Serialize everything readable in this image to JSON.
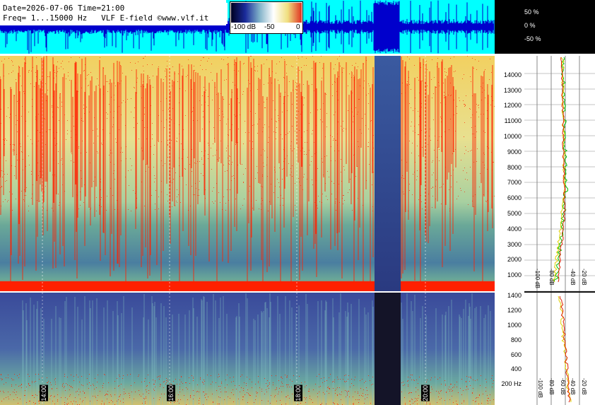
{
  "header": {
    "line1": "Date=2026-07-06 Time=21:00",
    "line2": "Freq= 1...15000 Hz   VLF E-field ©www.vlf.it"
  },
  "colorbar": {
    "labels": [
      "-100 dB",
      "-50",
      "0"
    ],
    "colors": [
      "#000020",
      "#1a2a9a",
      "#7fb0c8",
      "#ffffff",
      "#f0e080",
      "#e03020"
    ]
  },
  "amplitude_axis": [
    "50 %",
    "0 %",
    "-50 %"
  ],
  "colors": {
    "waveform_bg": "#00ffff",
    "waveform_trace": "#0000cc",
    "spectrum_red": "#ff2000",
    "spectrum_yellow": "#f0e080",
    "spectrum_green": "#7fb8a0",
    "spectrum_blue": "#2a3a8a"
  },
  "chart_data": [
    {
      "type": "heatmap",
      "title": "",
      "xlabel": "",
      "ylabel": "",
      "x_ticks": [
        "14:00",
        "16:00",
        "18:00",
        "20:00"
      ],
      "y_ticks": [
        "1000",
        "2000",
        "3000",
        "4000",
        "5000",
        "6000",
        "7000",
        "8000",
        "9000",
        "10000",
        "11000",
        "12000",
        "13000",
        "14000"
      ],
      "ylim": [
        1,
        15000
      ],
      "description_bands": "red noise floor below 500 Hz, green band 500-5000 Hz, yellow/red above 5000 Hz, dark blue gap near 18:30-18:40"
    },
    {
      "type": "heatmap",
      "title": "",
      "xlabel": "",
      "ylabel": "",
      "y_ticks": [
        "200 Hz",
        "400",
        "600",
        "800",
        "1000",
        "1200",
        "1400"
      ],
      "ylim": [
        0,
        1500
      ]
    },
    {
      "type": "line",
      "title": "",
      "x_ticks": [
        "-100 dB",
        "-80 dB",
        "-40 dB",
        "-20 dB"
      ],
      "series": [
        {
          "color": "#00c000"
        },
        {
          "color": "#ffff00"
        },
        {
          "color": "#e02000"
        }
      ]
    },
    {
      "type": "line",
      "title": "",
      "x_ticks": [
        "-100 dB",
        "-80 dB",
        "-60 dB",
        "-40 dB",
        "-20 dB"
      ],
      "series": [
        {
          "color": "#ffff00"
        },
        {
          "color": "#e02000"
        }
      ]
    }
  ]
}
